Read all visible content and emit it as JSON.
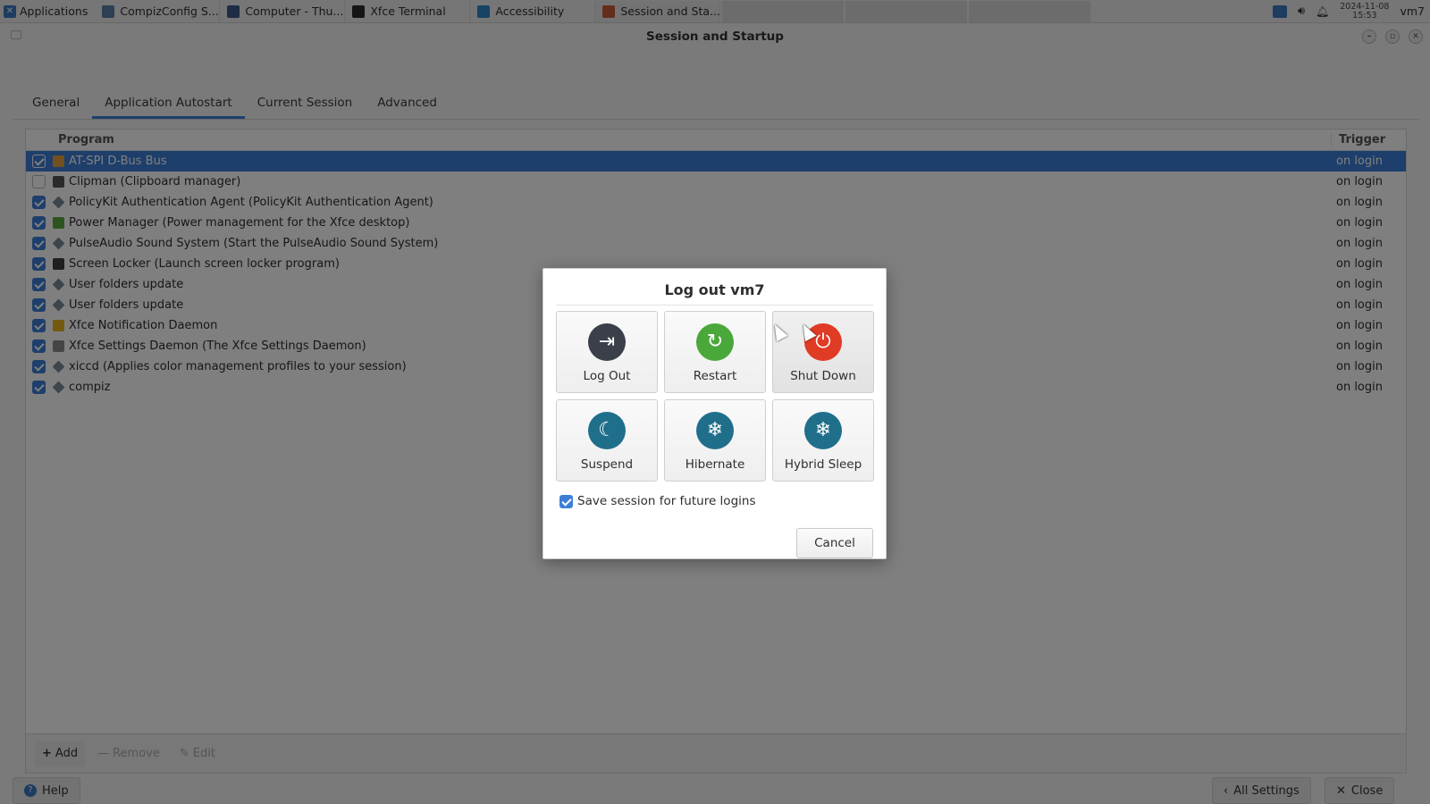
{
  "panel": {
    "apps_label": "Applications",
    "tasks": [
      {
        "label": "CompizConfig S...",
        "icon": "compizconfig-icon",
        "color": "#5a7fa8"
      },
      {
        "label": "Computer - Thu...",
        "icon": "file-manager-icon",
        "color": "#3c5a88"
      },
      {
        "label": "Xfce Terminal",
        "icon": "terminal-icon",
        "color": "#2b2b2b"
      },
      {
        "label": "Accessibility",
        "icon": "accessibility-icon",
        "color": "#2f86c8"
      },
      {
        "label": "Session and Sta...",
        "icon": "session-icon",
        "color": "#c95b3a"
      }
    ],
    "clock_date": "2024-11-08",
    "clock_time": "15:53",
    "user": "vm7"
  },
  "window": {
    "title": "Session and Startup",
    "tabs": [
      "General",
      "Application Autostart",
      "Current Session",
      "Advanced"
    ],
    "active_tab": "Application Autostart",
    "columns": {
      "program": "Program",
      "trigger": "Trigger"
    },
    "rows": [
      {
        "name": "AT-SPI D-Bus Bus",
        "trigger": "on login",
        "checked": true,
        "selected": true,
        "icon": "accessibility-icon",
        "color": "#e6a23c"
      },
      {
        "name": "Clipman (Clipboard manager)",
        "trigger": "on login",
        "checked": false,
        "selected": false,
        "icon": "clipboard-icon",
        "color": "#555555"
      },
      {
        "name": "PolicyKit Authentication Agent (PolicyKit Authentication Agent)",
        "trigger": "on login",
        "checked": true,
        "selected": false,
        "icon": "generic-app-icon",
        "color": "#7b8a9a"
      },
      {
        "name": "Power Manager (Power management for the Xfce desktop)",
        "trigger": "on login",
        "checked": true,
        "selected": false,
        "icon": "power-manager-icon",
        "color": "#5aa83c"
      },
      {
        "name": "PulseAudio Sound System (Start the PulseAudio Sound System)",
        "trigger": "on login",
        "checked": true,
        "selected": false,
        "icon": "generic-app-icon",
        "color": "#7b8a9a"
      },
      {
        "name": "Screen Locker (Launch screen locker program)",
        "trigger": "on login",
        "checked": true,
        "selected": false,
        "icon": "screen-locker-icon",
        "color": "#3c3c3c"
      },
      {
        "name": "User folders update",
        "trigger": "on login",
        "checked": true,
        "selected": false,
        "icon": "generic-app-icon",
        "color": "#7b8a9a"
      },
      {
        "name": "User folders update",
        "trigger": "on login",
        "checked": true,
        "selected": false,
        "icon": "generic-app-icon",
        "color": "#7b8a9a"
      },
      {
        "name": "Xfce Notification Daemon",
        "trigger": "on login",
        "checked": true,
        "selected": false,
        "icon": "bell-icon",
        "color": "#e8b21f"
      },
      {
        "name": "Xfce Settings Daemon (The Xfce Settings Daemon)",
        "trigger": "on login",
        "checked": true,
        "selected": false,
        "icon": "settings-daemon-icon",
        "color": "#8a8a8a"
      },
      {
        "name": "xiccd (Applies color management profiles to your session)",
        "trigger": "on login",
        "checked": true,
        "selected": false,
        "icon": "generic-app-icon",
        "color": "#7b8a9a"
      },
      {
        "name": "compiz",
        "trigger": "on login",
        "checked": true,
        "selected": false,
        "icon": "generic-app-icon",
        "color": "#7b8a9a"
      }
    ],
    "toolbar": {
      "add": "Add",
      "remove": "Remove",
      "edit": "Edit"
    },
    "footer": {
      "help": "Help",
      "all_settings": "All Settings",
      "close": "Close"
    }
  },
  "dialog": {
    "title": "Log out vm7",
    "actions": [
      {
        "label": "Log Out",
        "icon": "logout-icon",
        "color": "#3a3f4a",
        "glyph": "⇥"
      },
      {
        "label": "Restart",
        "icon": "restart-icon",
        "color": "#4aa83a",
        "glyph": "↻"
      },
      {
        "label": "Shut Down",
        "icon": "power-icon",
        "color": "#e03b24",
        "glyph": "⏻"
      },
      {
        "label": "Suspend",
        "icon": "suspend-icon",
        "color": "#1f6f8b",
        "glyph": "☾"
      },
      {
        "label": "Hibernate",
        "icon": "hibernate-icon",
        "color": "#1f6f8b",
        "glyph": "❄"
      },
      {
        "label": "Hybrid Sleep",
        "icon": "hybrid-sleep-icon",
        "color": "#1f6f8b",
        "glyph": "❄"
      }
    ],
    "save_session_label": "Save session for future logins",
    "save_session_checked": true,
    "cancel_label": "Cancel"
  }
}
